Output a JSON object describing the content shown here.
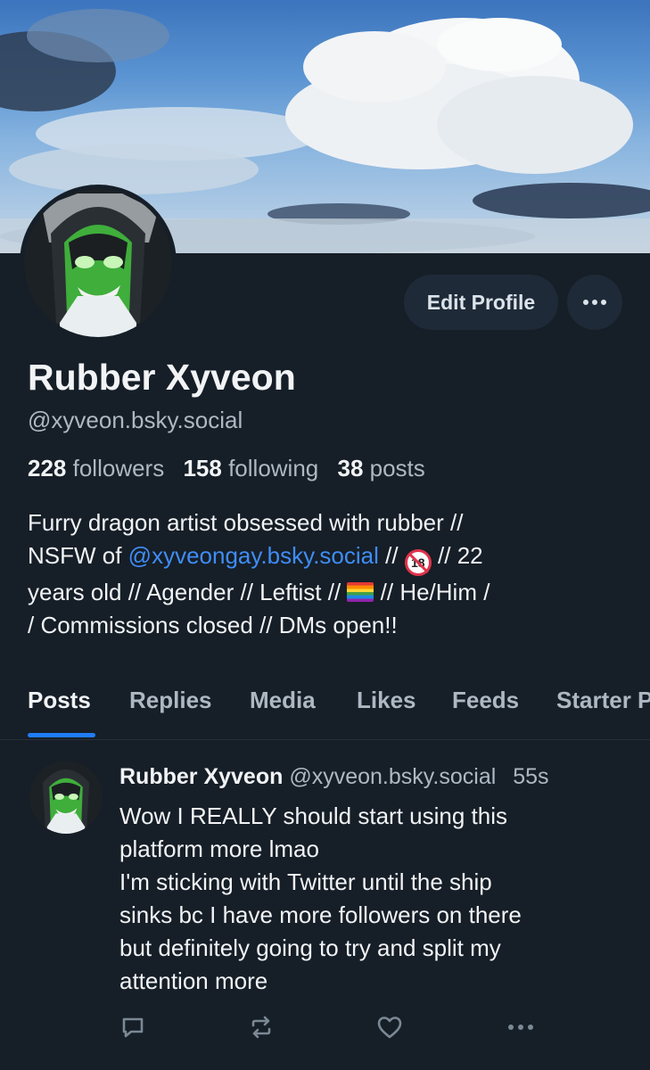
{
  "profile": {
    "name": "Rubber Xyveon",
    "handle": "@xyveon.bsky.social",
    "edit_label": "Edit Profile",
    "followers_count": "228",
    "followers_label": "followers",
    "following_count": "158",
    "following_label": "following",
    "posts_count": "38",
    "posts_label": "posts",
    "bio": {
      "line1": "Furry dragon artist obsessed with rubber //",
      "line2_pre": "NSFW of ",
      "line2_link": "@xyveongay.bsky.social",
      "line2_mid": " // ",
      "line2_post": " // 22",
      "line3_pre": "years old // Agender // Leftist // ",
      "line3_post": " // He/Him /",
      "line4": "/ Commissions closed // DMs open!!"
    }
  },
  "tabs": [
    {
      "label": "Posts",
      "active": true
    },
    {
      "label": "Replies",
      "active": false
    },
    {
      "label": "Media",
      "active": false
    },
    {
      "label": "Likes",
      "active": false
    },
    {
      "label": "Feeds",
      "active": false
    },
    {
      "label": "Starter Packs",
      "active": false
    }
  ],
  "post": {
    "author_name": "Rubber Xyveon",
    "author_handle": "@xyveon.bsky.social",
    "time": "55s",
    "lines": [
      "Wow I REALLY should start using this",
      "platform more lmao",
      "I'm sticking with Twitter until the ship",
      "sinks bc I have more followers on there",
      "but definitely going to try and split my",
      "attention more"
    ]
  },
  "icons": {
    "more": "ellipsis-icon",
    "reply": "reply-icon",
    "repost": "repost-icon",
    "like": "heart-icon",
    "post_more": "ellipsis-icon"
  },
  "colors": {
    "background": "#161e27",
    "accent": "#1f7cf5",
    "link": "#3f8df5",
    "muted": "#aeb8c3"
  }
}
